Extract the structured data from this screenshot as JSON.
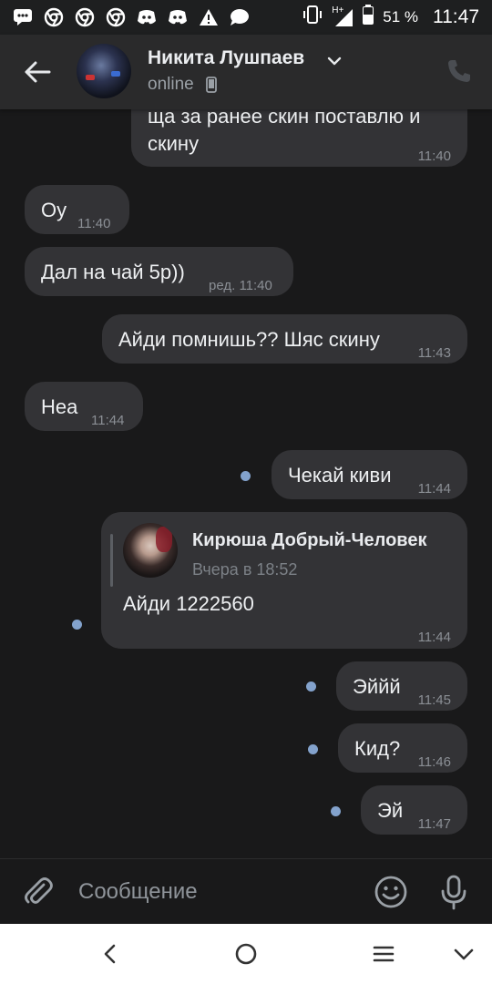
{
  "status_bar": {
    "battery": "51 %",
    "network": "H+",
    "time": "11:47",
    "icons": [
      "message-icon",
      "chrome-icon",
      "chrome-icon",
      "chrome-icon",
      "discord-icon",
      "discord-icon",
      "warning-icon",
      "chat-icon",
      "vibrate-icon",
      "signal-icon",
      "battery-icon"
    ]
  },
  "header": {
    "name": "Никита Лушпаев",
    "status": "online",
    "icons": [
      "back-arrow-icon",
      "chevron-down-icon",
      "mobile-icon",
      "phone-icon"
    ]
  },
  "messages": [
    {
      "dir": "out",
      "text_lines": [
        "ща за ранее скин поставлю и",
        "скину"
      ],
      "time": "11:40"
    },
    {
      "dir": "in",
      "text": "Оу",
      "time": "11:40"
    },
    {
      "dir": "in",
      "text": "Дал на чай 5р))",
      "time": "ред. 11:40"
    },
    {
      "dir": "out",
      "text": "Айди помнишь?? Шяс скину",
      "time": "11:43"
    },
    {
      "dir": "in",
      "text": "Неа",
      "time": "11:44"
    },
    {
      "dir": "out",
      "text": "Чекай киви",
      "time": "11:44",
      "unread": true
    },
    {
      "dir": "out",
      "forwarded": {
        "name": "Кирюша Добрый-Человек",
        "date": "Вчера в 18:52",
        "text": "Айди 1222560"
      },
      "time": "11:44",
      "unread": true
    },
    {
      "dir": "out",
      "text": "Эййй",
      "time": "11:45",
      "unread": true
    },
    {
      "dir": "out",
      "text": "Кид?",
      "time": "11:46",
      "unread": true
    },
    {
      "dir": "out",
      "text": "Эй",
      "time": "11:47",
      "unread": true
    }
  ],
  "composer": {
    "placeholder": "Сообщение",
    "icons": [
      "paperclip-icon",
      "emoji-icon",
      "microphone-icon"
    ]
  },
  "nav_bar": {
    "icons": [
      "nav-back-icon",
      "nav-home-icon",
      "nav-menu-icon",
      "nav-collapse-icon"
    ]
  },
  "colors": {
    "background": "#19191a",
    "header": "#2a2a2b",
    "bubble": "#333336",
    "unread_dot": "#83a2cc",
    "time_text": "#8b8f95"
  }
}
